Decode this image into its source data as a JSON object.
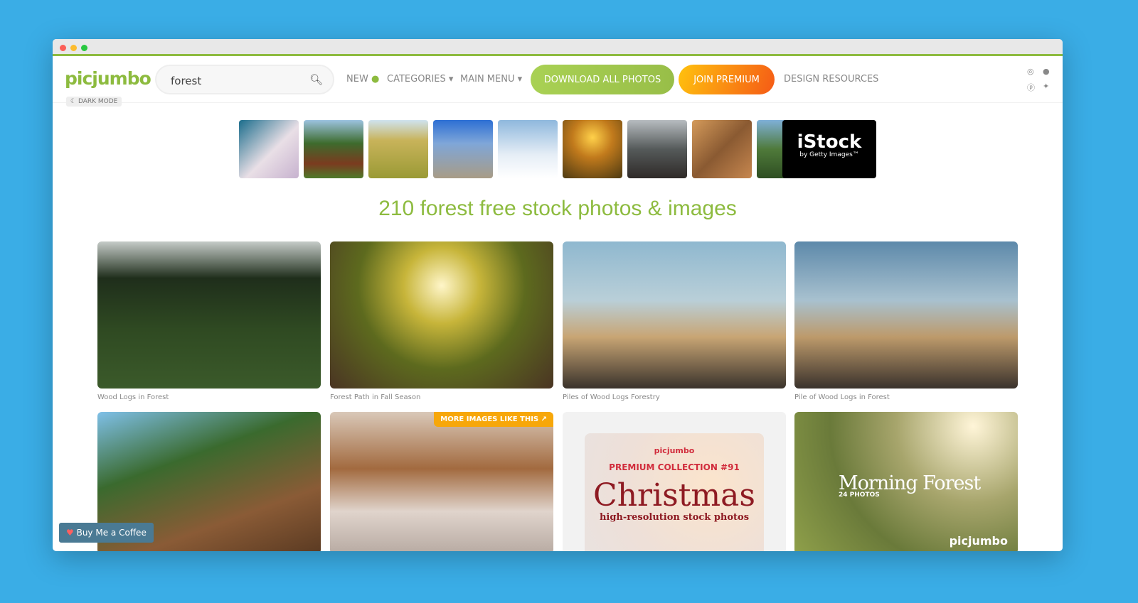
{
  "header": {
    "logo": "picjumbo",
    "dark_mode": "DARK MODE",
    "search_value": "forest",
    "nav": {
      "new": "NEW",
      "categories": "CATEGORIES ▾",
      "main_menu": "MAIN MENU ▾",
      "download_all": "DOWNLOAD ALL PHOTOS",
      "join_premium": "JOIN PREMIUM",
      "design_resources": "DESIGN RESOURCES"
    },
    "social": [
      "instagram-icon",
      "facebook-icon",
      "pinterest-icon",
      "twitter-icon"
    ]
  },
  "ad": {
    "brand": "iStock",
    "sub": "by Getty Images™"
  },
  "heading": "210 forest free stock photos & images",
  "photos": [
    {
      "caption": "Wood Logs in Forest"
    },
    {
      "caption": "Forest Path in Fall Season"
    },
    {
      "caption": "Piles of Wood Logs Forestry"
    },
    {
      "caption": "Pile of Wood Logs in Forest"
    }
  ],
  "row2": {
    "more_label": "MORE IMAGES LIKE THIS ↗",
    "premium_logo": "picjumbo",
    "premium_collection": "PREMIUM COLLECTION #91",
    "premium_title": "Christmas",
    "premium_sub": "high-resolution stock photos",
    "morning_title": "Morning Forest",
    "morning_count": "24 PHOTOS",
    "morning_logo": "picjumbo"
  },
  "coffee": "Buy Me a Coffee",
  "colors": {
    "brand": "#8dbb3f",
    "background": "#3aade6"
  }
}
